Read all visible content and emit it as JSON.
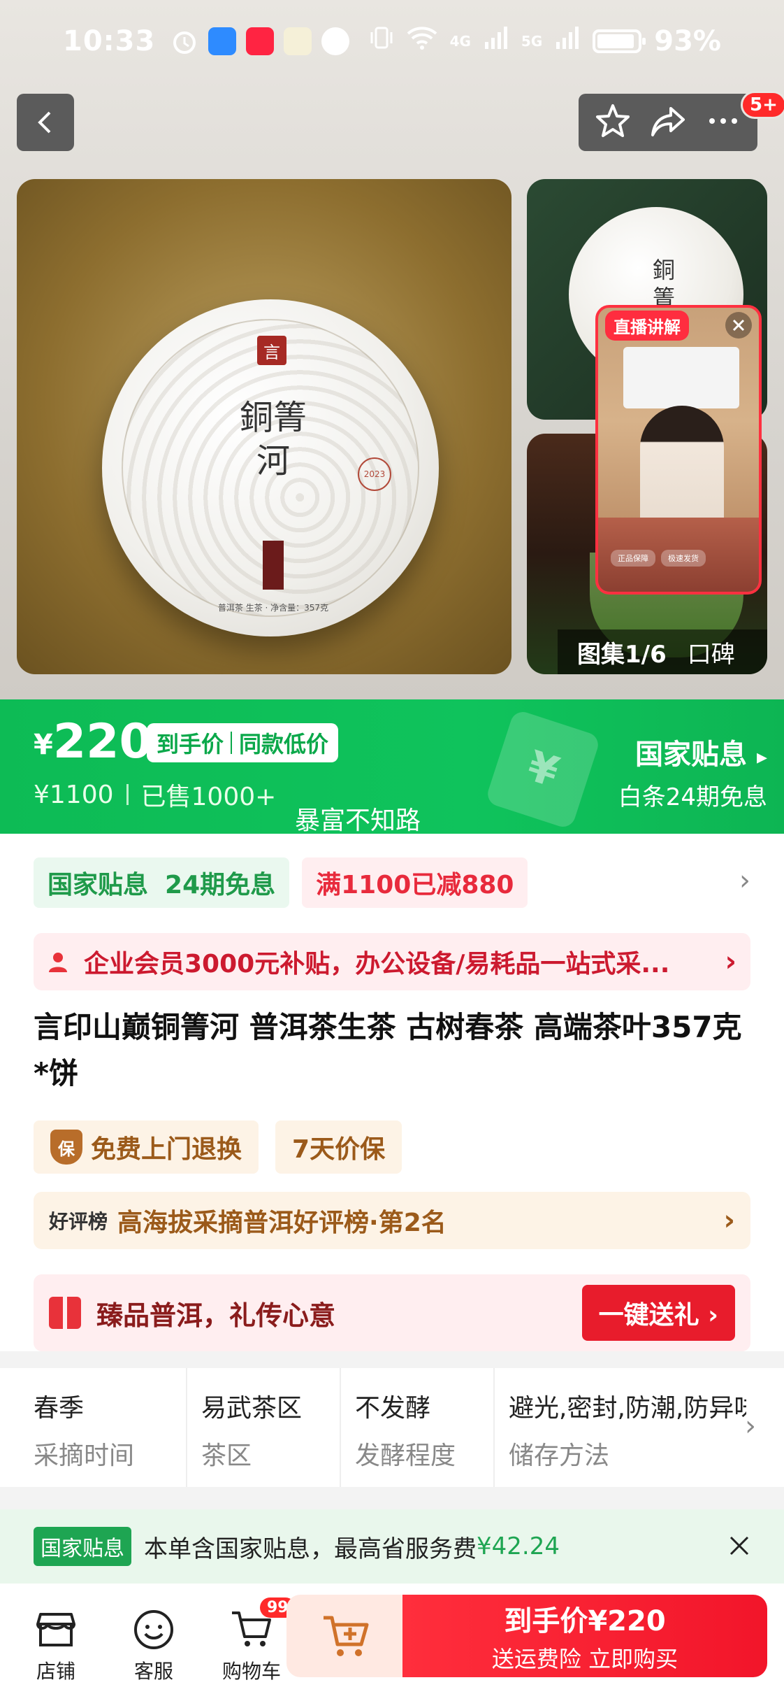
{
  "status": {
    "time": "10:33",
    "network1": "4G",
    "network2": "5G",
    "battery": "93%"
  },
  "header": {
    "more_badge": "5+"
  },
  "gallery": {
    "main_cake_text": "銅箐河",
    "cake_seal": "言",
    "cake_stamp": "2023",
    "cake_small_text": "普洱茶 生茶 · 净含量：357克",
    "thumb_text": "銅箐河",
    "counter": "图集1/6",
    "review_label": "口碑",
    "live_label": "直播讲解",
    "live_btn1": "正品保障",
    "live_btn2": "极速发货"
  },
  "price": {
    "currency": "¥",
    "amount": "220",
    "tag1": "到手价",
    "tag2": "同款低价",
    "original": "¥1100",
    "sold": "已售1000+",
    "subsidy_title": "国家贴息",
    "subsidy_sub": "白条24期免息",
    "watermark": "暴富不知路"
  },
  "promos": {
    "green_a": "国家贴息",
    "green_b": "24期免息",
    "red": "满1100已减880"
  },
  "vip": {
    "text": "企业会员3000元补贴，办公设备/易耗品一站式采..."
  },
  "product": {
    "title": "言印山巅铜箐河 普洱茶生茶 古树春茶 高端茶叶357克*饼"
  },
  "services": {
    "shield": "保",
    "tag1": "免费上门退换",
    "tag2": "7天价保"
  },
  "rank": {
    "tag": "好评榜",
    "text": "高海拔采摘普洱好评榜·第2名"
  },
  "gift": {
    "text": "臻品普洱，礼传心意",
    "button": "一键送礼"
  },
  "attributes": [
    {
      "value": "春季",
      "key": "采摘时间"
    },
    {
      "value": "易武茶区",
      "key": "茶区"
    },
    {
      "value": "不发酵",
      "key": "发酵程度"
    },
    {
      "value": "避光,密封,防潮,防异味",
      "key": "储存方法"
    }
  ],
  "notice": {
    "tag": "国家贴息",
    "text": "本单含国家贴息，最高省服务费",
    "amount": "¥42.24"
  },
  "bottom": {
    "store": "店铺",
    "service": "客服",
    "cart": "购物车",
    "cart_badge": "99",
    "buy_main": "到手价¥220",
    "buy_sub": "送运费险 立即购买"
  },
  "colors": {
    "green": "#0fc35c",
    "red": "#e81c2c",
    "orange_text": "#9b5a1a"
  }
}
